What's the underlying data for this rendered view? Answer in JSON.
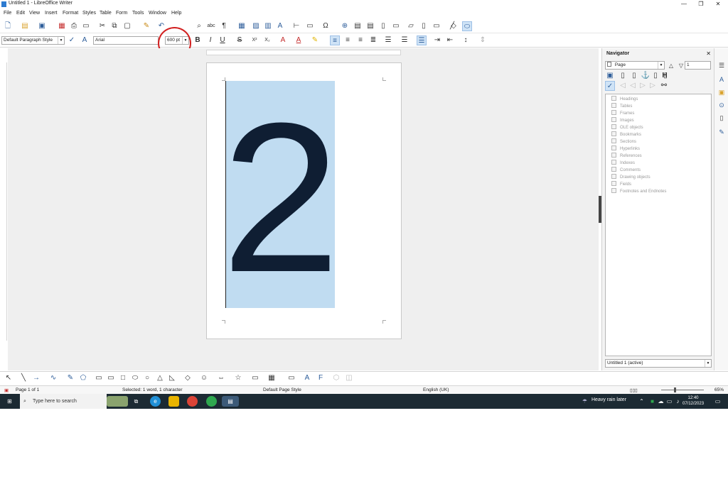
{
  "window": {
    "title": "Untitled 1 - LibreOffice Writer",
    "min_icon": "—",
    "max_icon": "❐",
    "close_icon": "✕"
  },
  "menu": [
    "File",
    "Edit",
    "View",
    "Insert",
    "Format",
    "Styles",
    "Table",
    "Form",
    "Tools",
    "Window",
    "Help"
  ],
  "formatting": {
    "paragraph_style": "Default Paragraph Style",
    "font_name": "Arial",
    "font_size": "600 pt",
    "bold": "B",
    "italic": "I",
    "underline": "U",
    "strike": "S",
    "superscript": "X²",
    "subscript": "X₂"
  },
  "document": {
    "text": "2"
  },
  "navigator": {
    "title": "Navigator",
    "category": "Page",
    "page_number": "1",
    "items": [
      "Headings",
      "Tables",
      "Frames",
      "Images",
      "OLE objects",
      "Bookmarks",
      "Sections",
      "Hyperlinks",
      "References",
      "Indexes",
      "Comments",
      "Drawing objects",
      "Fields",
      "Footnotes and Endnotes"
    ],
    "document_select": "Untitled 1 (active)"
  },
  "status": {
    "page": "Page 1 of 1",
    "selection": "Selected: 1 word, 1 character",
    "page_style": "Default Page Style",
    "language": "English (UK)",
    "zoom": "65%"
  },
  "taskbar": {
    "search_placeholder": "Type here to search",
    "weather": "Heavy rain later",
    "time": "12:40",
    "date": "07/12/2023"
  },
  "colors": {
    "selection": "#c0dcf1",
    "text": "#0f1e33",
    "annotation": "#d22020",
    "taskbar": "#1c2a33"
  }
}
